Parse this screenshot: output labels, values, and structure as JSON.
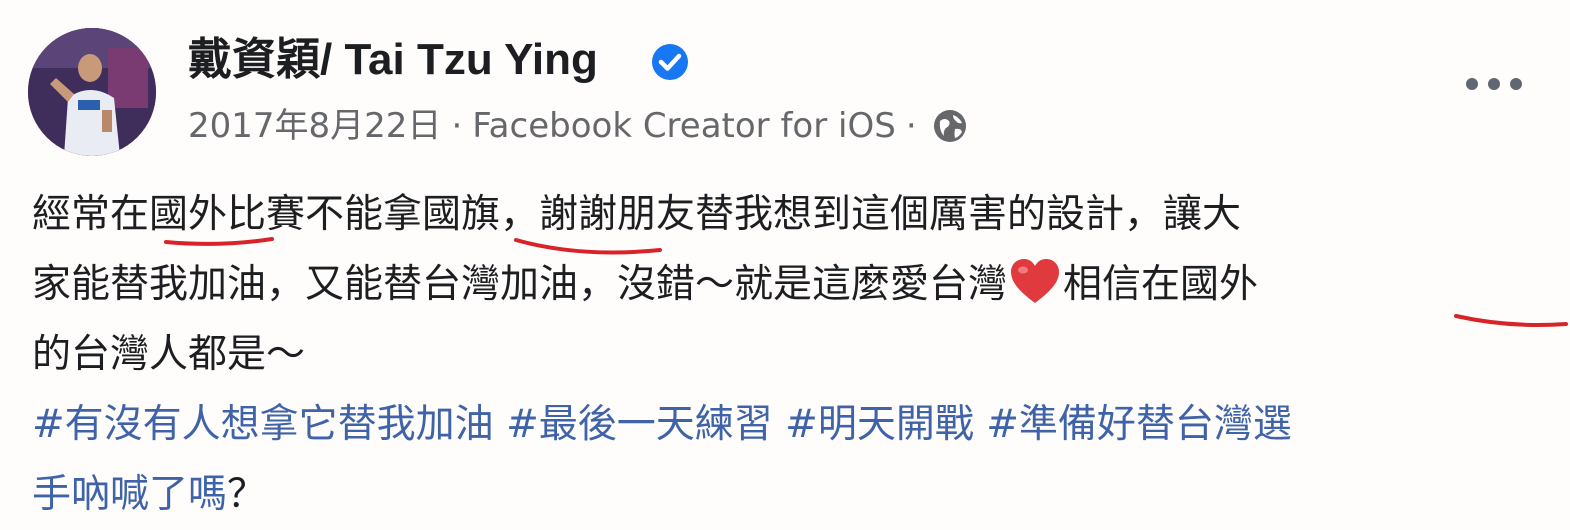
{
  "post": {
    "author": "戴資穎/ Tai Tzu Ying",
    "date": "2017年8月22日",
    "separator": "·",
    "app": "Facebook Creator for iOS",
    "icons": {
      "verified": "verified-badge-icon",
      "audience": "globe-icon",
      "more": "more-options-icon",
      "emoji": "red-heart-emoji"
    },
    "colors": {
      "verified": "#1877f2",
      "hashtag": "#3f63a8",
      "heart": "#e0393e",
      "handwritten_underline": "#d8232a"
    },
    "body": {
      "line1": "經常在國外比賽不能拿國旗，謝謝朋友替我想到這個厲害的設計，讓大",
      "line2_a": "家能替我加油，又能替台灣加油，沒錯～就是這麼愛台灣",
      "line2_b": "相信在國外",
      "line3": "的台灣人都是～"
    },
    "hashtags": {
      "line1": "#有沒有人想拿它替我加油 #最後一天練習 #明天開戰 #準備好替台灣選",
      "line2": "手吶喊了嗎"
    },
    "trailing_punctuation": "？"
  }
}
